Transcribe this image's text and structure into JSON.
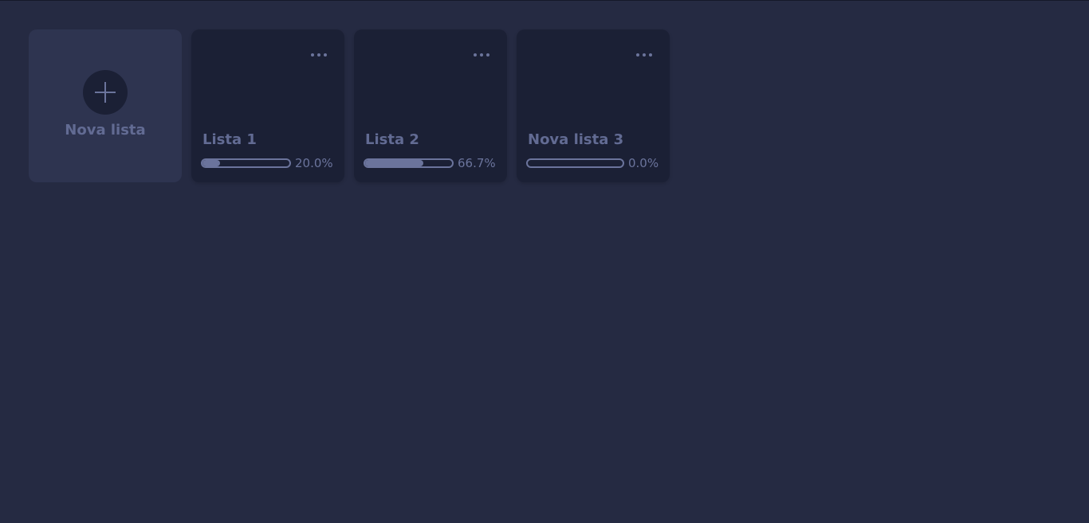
{
  "new_list": {
    "label": "Nova lista",
    "icon": "plus-icon"
  },
  "lists": [
    {
      "title": "Lista 1",
      "progress": 0.2,
      "progress_label": "20.0%"
    },
    {
      "title": "Lista 2",
      "progress": 0.667,
      "progress_label": "66.7%"
    },
    {
      "title": "Nova lista 3",
      "progress": 0.0,
      "progress_label": "0.0%"
    }
  ],
  "menu_icon": "more-horizontal-icon",
  "colors": {
    "background": "#252a42",
    "card": "#1b2035",
    "new_card": "#2e3450",
    "accent": "#6b749c"
  }
}
